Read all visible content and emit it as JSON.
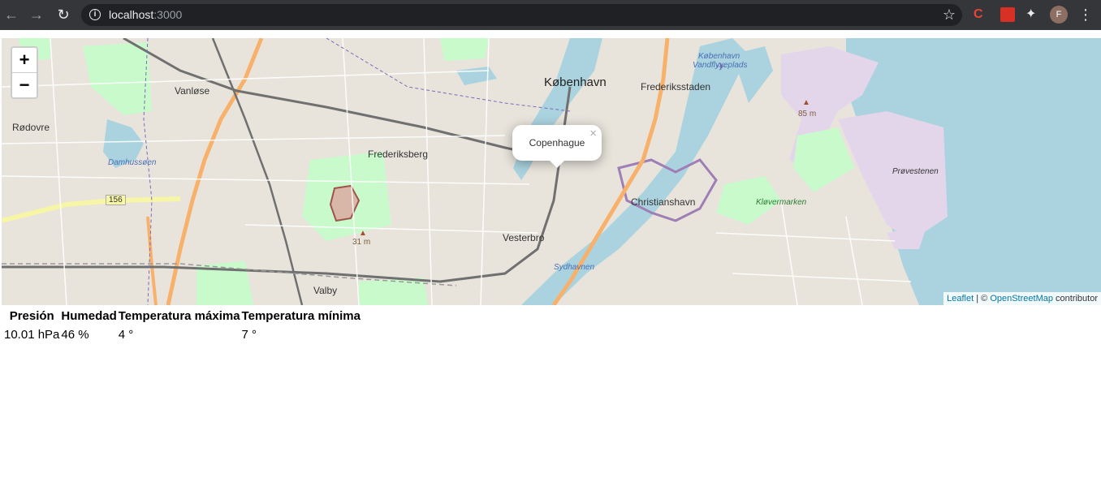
{
  "browser": {
    "url_host": "localhost",
    "url_port": ":3000",
    "profile_initial": "F"
  },
  "map": {
    "zoom_in_label": "+",
    "zoom_out_label": "−",
    "popup_text": "Copenhague",
    "popup_close": "×",
    "places": {
      "kobenhavn": "København",
      "frederiksstaden": "Frederiksstaden",
      "vanlose": "Vanløse",
      "rodovre": "Rødovre",
      "frederiksberg": "Frederiksberg",
      "christianshavn": "Christianshavn",
      "vesterbro": "Vesterbro",
      "valby": "Valby",
      "provestenen": "Prøvestenen",
      "damhussoen": "Damhussøen",
      "klovermarken": "Kløvermarken",
      "sydhavnen": "Sydhavnen",
      "vandflyveplads_1": "København",
      "vandflyveplads_2": "Vandflyveplads",
      "elev_85": "85 m",
      "elev_31": "31 m",
      "road_156": "156"
    },
    "attribution": {
      "leaflet": "Leaflet",
      "sep": " | © ",
      "osm": "OpenStreetMap",
      "contrib": " contributor"
    },
    "colors": {
      "water": "#aad3df",
      "park": "#c8facc",
      "land": "#f2efe9",
      "motorway": "#f8b16b"
    }
  },
  "table": {
    "headers": [
      "Presión",
      "Humedad",
      "Temperatura máxima",
      "Temperatura mínima"
    ],
    "row": [
      "10.01 hPa",
      "46 %",
      "4 °",
      "7 °"
    ]
  }
}
